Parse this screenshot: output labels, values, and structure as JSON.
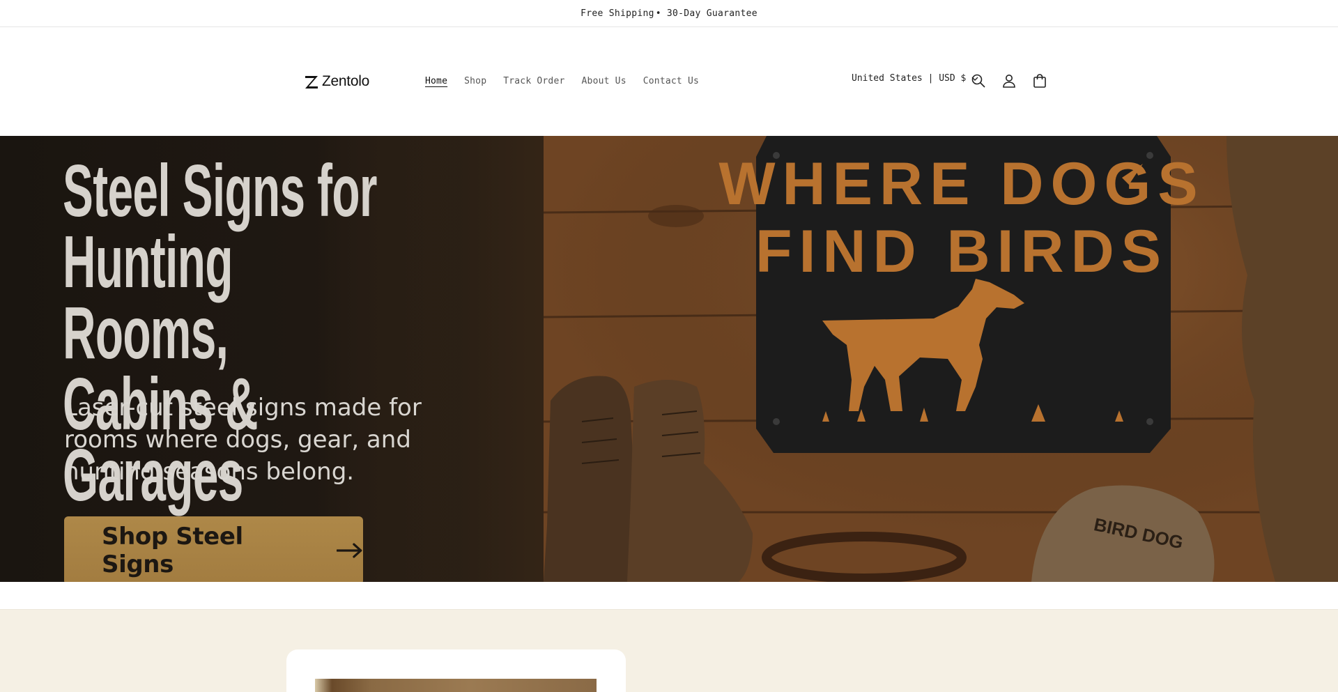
{
  "announcement": {
    "item1": "Free Shipping",
    "separator": "•",
    "item2": "30-Day Guarantee"
  },
  "header": {
    "logo_text": "Zentolo",
    "nav": [
      {
        "label": "Home",
        "active": true
      },
      {
        "label": "Shop",
        "active": false
      },
      {
        "label": "Track Order",
        "active": false
      },
      {
        "label": "About Us",
        "active": false
      },
      {
        "label": "Contact Us",
        "active": false
      }
    ],
    "locale": "United States | USD $",
    "icons": [
      "search-icon",
      "account-icon",
      "cart-icon"
    ]
  },
  "hero": {
    "title_line1": "Steel Signs for",
    "title_line2": "Hunting Rooms,",
    "title_line3": "Cabins & Garages",
    "subtitle": "Laser-cut steel signs made for rooms where dogs, gear, and hunting seasons belong.",
    "button_label": "Shop Steel Signs",
    "sign_line1": "WHERE DOGS",
    "sign_line2": "FIND BIRDS",
    "cap_text": "BIRD DOG"
  },
  "colors": {
    "accent_button": "#a9833f",
    "cream_section": "#f5f0e4",
    "hero_dark": "#1b1611",
    "wood": "#7a4d28"
  }
}
